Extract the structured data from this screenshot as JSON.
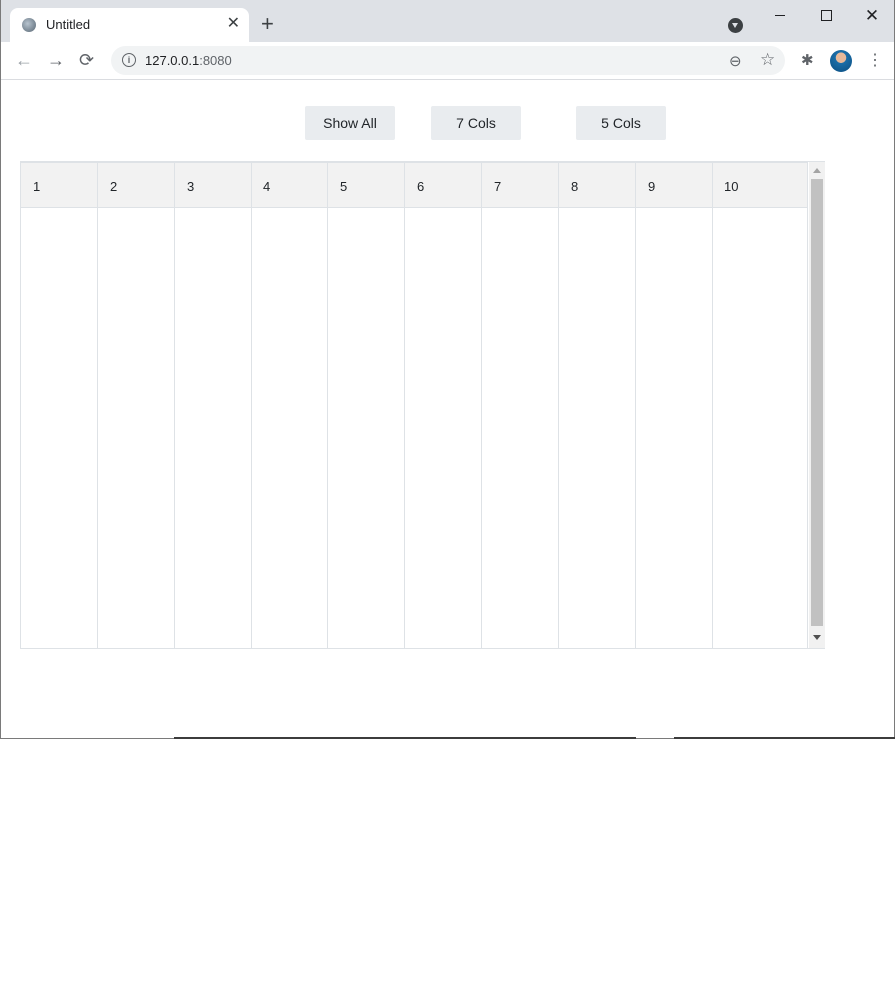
{
  "browser": {
    "tab_title": "Untitled",
    "tab_close": "✕",
    "new_tab": "+",
    "url_host": "127.0.0.1",
    "url_port": ":8080",
    "close_window": "✕"
  },
  "icons": {
    "back": "←",
    "forward": "→",
    "reload": "⟳",
    "info": "i",
    "zoom": "⊖",
    "star": "☆",
    "extensions": "✱",
    "menu": "⋮"
  },
  "buttons": {
    "show_all": "Show All",
    "seven_cols": "7 Cols",
    "five_cols": "5 Cols"
  },
  "grid": {
    "columns": [
      "1",
      "2",
      "3",
      "4",
      "5",
      "6",
      "7",
      "8",
      "9",
      "10"
    ]
  }
}
